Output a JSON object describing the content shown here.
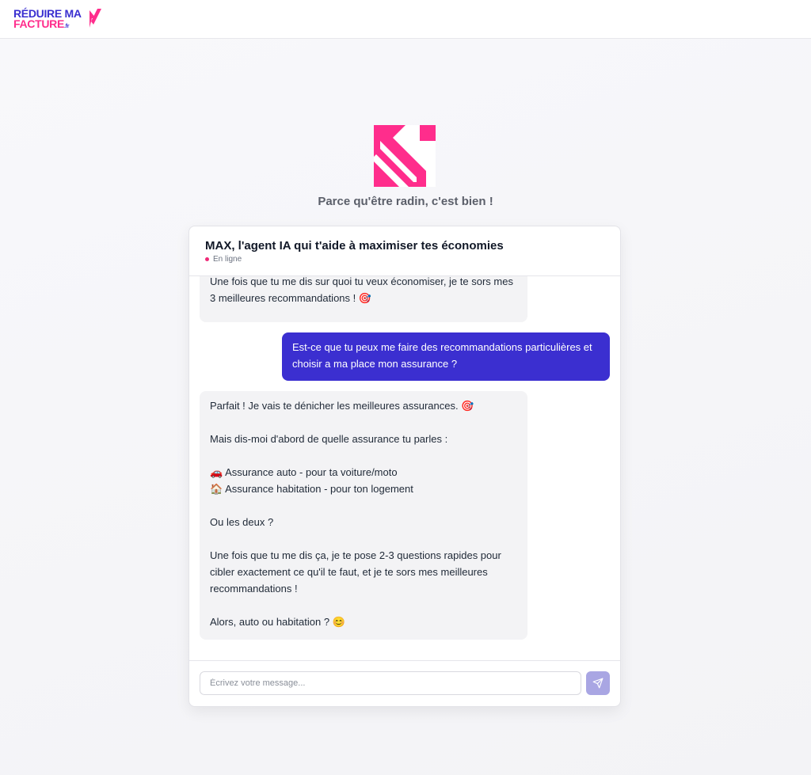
{
  "brand": {
    "logo_line1": "RÉDUIRE MA",
    "logo_line2": "FACTURE",
    "logo_tld": ".fr",
    "primary_color": "#3b2fd0",
    "accent_color": "#ff2d8c"
  },
  "hero": {
    "icon": "brand-arrow-icon",
    "tagline": "Parce qu'être radin, c'est bien !"
  },
  "chat": {
    "title": "MAX, l'agent IA qui t'aide à maximiser tes économies",
    "status": "En ligne",
    "messages": [
      {
        "role": "bot",
        "paragraphs": [
          "Une fois que tu me dis sur quoi tu veux économiser, je te sors mes 3 meilleures recommandations ! 🎯"
        ]
      },
      {
        "role": "user",
        "paragraphs": [
          "Est-ce que tu peux me faire des recommandations particulières et choisir a ma place mon assurance ?"
        ]
      },
      {
        "role": "bot",
        "paragraphs": [
          "Parfait ! Je vais te dénicher les meilleures assurances. 🎯",
          "Mais dis-moi d'abord de quelle assurance tu parles :",
          "🚗 Assurance auto - pour ta voiture/moto",
          "🏠 Assurance habitation - pour ton logement",
          "Ou les deux ?",
          "Une fois que tu me dis ça, je te pose 2-3 questions rapides pour cibler exactement ce qu'il te faut, et je te sors mes meilleures recommandations !",
          "Alors, auto ou habitation ? 😊"
        ]
      }
    ],
    "input": {
      "value": "",
      "placeholder": "Écrivez votre message..."
    },
    "send_icon": "send-icon"
  }
}
